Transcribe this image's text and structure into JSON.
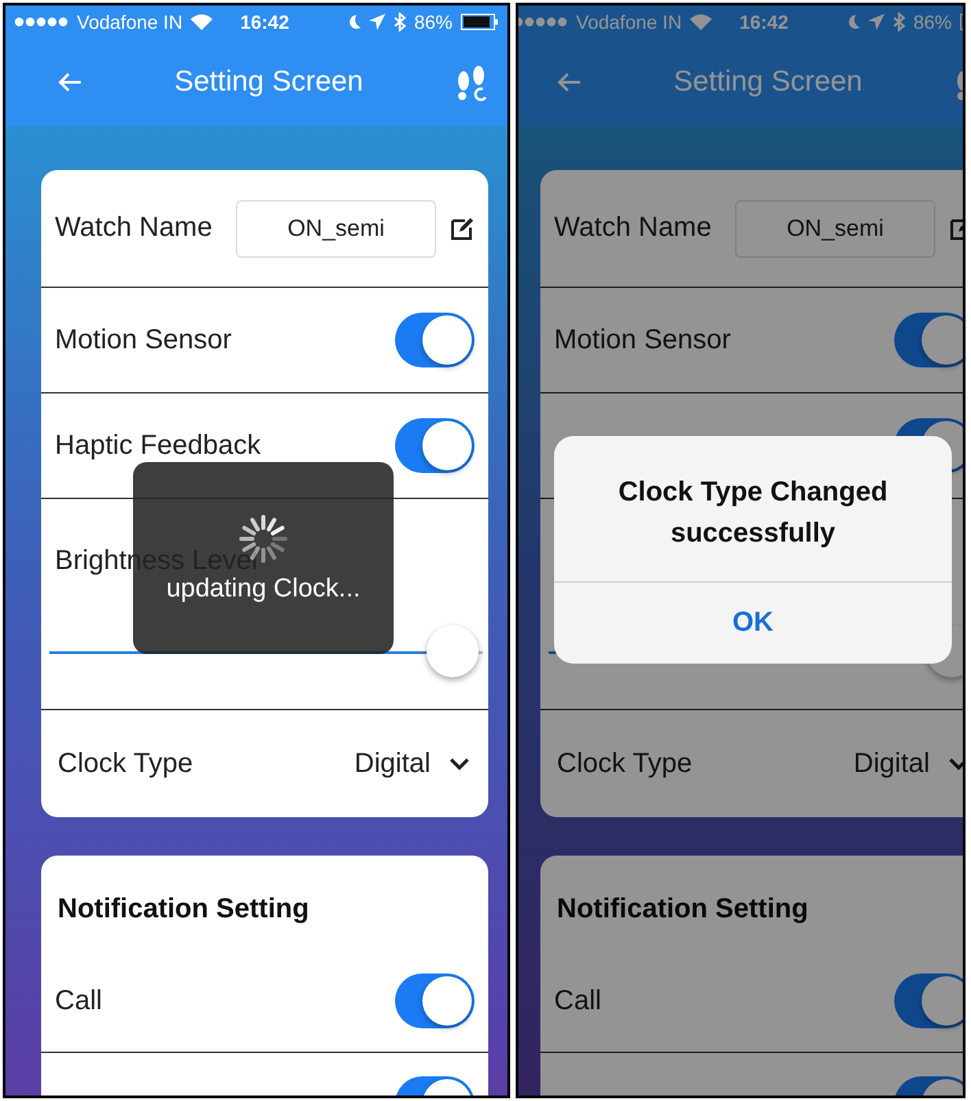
{
  "screens": [
    {
      "status_bar": {
        "carrier": "Vodafone IN",
        "time": "16:42",
        "battery": "86%"
      },
      "title": "Setting Screen",
      "settings": [
        {
          "kind": "field",
          "label": "Watch Name",
          "value": "ON_semi"
        },
        {
          "kind": "toggle",
          "label": "Motion Sensor",
          "on": true
        },
        {
          "kind": "toggle",
          "label": "Haptic Feedback",
          "on": true
        },
        {
          "kind": "slider",
          "label": "Brightness Level",
          "level": 0.93
        },
        {
          "kind": "dropdown",
          "label": "Clock Type",
          "value": "Digital"
        }
      ],
      "notification": {
        "title": "Notification Setting",
        "rows": [
          {
            "label": "Call",
            "on": true
          },
          {
            "on": true
          }
        ]
      },
      "overlay": {
        "kind": "toast",
        "text": "updating Clock..."
      }
    },
    {
      "status_bar": {
        "carrier": "Vodafone IN",
        "time": "16:42",
        "battery": "86%"
      },
      "title": "Setting Screen",
      "settings": [
        {
          "kind": "field",
          "label": "Watch Name",
          "value": "ON_semi"
        },
        {
          "kind": "toggle",
          "label": "Motion Sensor",
          "on": true
        },
        {
          "kind": "toggle",
          "on": true
        },
        {
          "kind": "slider",
          "level": 0.93
        },
        {
          "kind": "dropdown",
          "label": "Clock Type",
          "value": "Digital"
        }
      ],
      "notification": {
        "title": "Notification Setting",
        "rows": [
          {
            "label": "Call",
            "on": true
          },
          {
            "on": true
          }
        ]
      },
      "overlay": {
        "kind": "alert",
        "message": "Clock Type Changed successfully",
        "button": "OK"
      }
    }
  ]
}
